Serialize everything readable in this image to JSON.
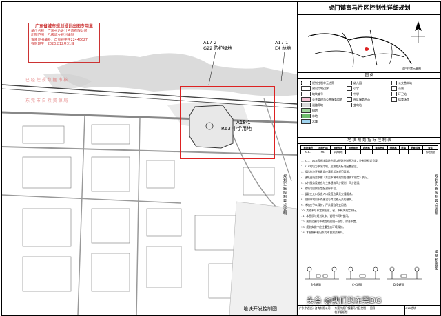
{
  "map": {
    "stamp": {
      "title": "广东省城市规划设计出图专用章",
      "lines": [
        "单位名称：广东中达设计咨询有限公司",
        "出图范围：乙级城乡规划编制",
        "资质证书编号：自资规甲字22440627",
        "有效期至：2023年12月31日"
      ]
    },
    "faded_text": [
      "已 经 控 规 数 据 审 核",
      "东 莞 市 自 然 资 源 局"
    ],
    "labels": {
      "a17_2_code": "A17-2",
      "a17_2_use": "G22 防护绿地",
      "a17_1_code": "A17-1",
      "a17_1_use": "E4 林地",
      "a18_1_code": "A18-1",
      "a18_1_use": "R63 中学用地"
    },
    "bottom_caption": "地块开发控制图",
    "right_caption": "规划实施控制要点说明"
  },
  "panel": {
    "title": "虎门镇富马片区控制性详细规划",
    "location_caption": "项目位置示意图",
    "legend_head": "图    例",
    "index_head": "地 块 规 划 指 标 控 制 表",
    "notes_head": "规划实施控制要点说明",
    "road_head": "道路断面图",
    "legend": [
      {
        "label": "规划控制单元边界",
        "color": "#ffffff"
      },
      {
        "label": "建设用地边界",
        "color": "#ffffff"
      },
      {
        "label": "地块编号",
        "color": "#ffffff"
      },
      {
        "label": "公共管理与公共服务用地",
        "color": "#f7c6d8"
      },
      {
        "label": "道路用地",
        "color": "#d9d9d9"
      },
      {
        "label": "绿地",
        "color": "#9ed59a"
      },
      {
        "label": "林地",
        "color": "#6dbb6a"
      },
      {
        "label": "水域",
        "color": "#9fd3ee"
      },
      {
        "label": "幼儿园",
        "color": "#ffffff"
      },
      {
        "label": "小学",
        "color": "#ffffff"
      },
      {
        "label": "中学",
        "color": "#ffffff"
      },
      {
        "label": "社区服务中心",
        "color": "#ffffff"
      },
      {
        "label": "变电站",
        "color": "#ffffff"
      },
      {
        "label": "公交首末站",
        "color": "#ffffff"
      },
      {
        "label": "公厕",
        "color": "#ffffff"
      },
      {
        "label": "环卫站",
        "color": "#ffffff"
      },
      {
        "label": "体育场馆",
        "color": "#ffffff"
      }
    ],
    "index_table": {
      "headers": [
        "地块编号",
        "用地代码",
        "用地性质",
        "用地面积",
        "容积率",
        "建筑密度",
        "绿地率",
        "限高",
        "配套设施",
        "备注"
      ],
      "rows": [
        [
          "A18-1",
          "R63",
          "中学用地",
          "",
          "",
          "",
          "",
          "",
          "",
          "供地规划"
        ]
      ]
    },
    "notes": [
      "1. A17、A18等地块用地性质以规划控制图为准，控制指标详见表。",
      "2. A18地块为中学用地，应按相关标准配套建设。",
      "3. 规划地块开发建设应满足相关规范要求。",
      "4. 建筑退线要求按《东莞市城市规划管理技术规定》执行。",
      "5. 公共服务设施应与主体建筑同步规划、同步建设。",
      "6. 地块内应按规定配建停车位。",
      "7. 道路交叉口及出入口设置应满足交通要求。",
      "8. 防护绿地内不得建设与其功能无关的建筑。",
      "9. 林地应予以保护，严禁擅自改变用途。",
      "10. 其他未尽事宜按国家、省、市有关规定执行。",
      "11. 本图须与规划文本、说明书同时使用。",
      "12. 规划范围内市政管线应统一规划、综合布置。",
      "13. 规划实施中应注重生态环境保护。",
      "14. 本图解释权归东莞市自然资源局。"
    ],
    "road_sections": [
      "B-B断面",
      "C-C断面",
      "D-D断面"
    ],
    "footer": [
      "广东中达设计咨询有限公司",
      "东莞市虎门镇富马片区控制性详细规划",
      "图号",
      "A18地块"
    ]
  },
  "watermark": "头条 @我们的东莞DG"
}
